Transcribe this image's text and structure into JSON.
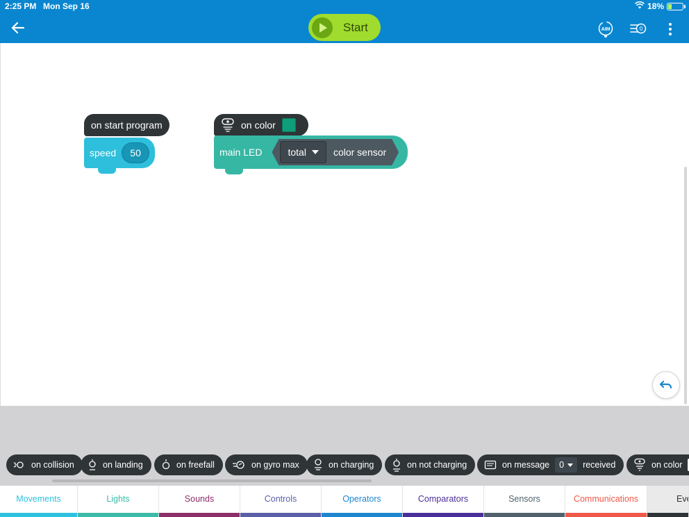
{
  "status": {
    "time": "2:25 PM",
    "date": "Mon Sep 16",
    "battery": "18%"
  },
  "toolbar": {
    "start_label": "Start"
  },
  "canvas": {
    "start_block": {
      "label": "on start program"
    },
    "speed_block": {
      "label": "speed",
      "value": "50"
    },
    "color_event": {
      "label": "on color",
      "swatch_color": "#0f9e7a"
    },
    "led_block": {
      "label": "main LED",
      "dropdown": "total",
      "sensor_label": "color sensor"
    }
  },
  "palette": {
    "blocks": [
      {
        "label": "on collision"
      },
      {
        "label": "on landing"
      },
      {
        "label": "on freefall"
      },
      {
        "label": "on gyro max"
      },
      {
        "label": "on charging"
      },
      {
        "label": "on not charging"
      },
      {
        "label": "on message",
        "dropdown": "0",
        "suffix": "received"
      },
      {
        "label": "on color"
      }
    ]
  },
  "tabs": [
    {
      "label": "Movements",
      "color": "#2fc2e0"
    },
    {
      "label": "Lights",
      "color": "#3dbba8"
    },
    {
      "label": "Sounds",
      "color": "#8f2f6a"
    },
    {
      "label": "Controls",
      "color": "#5a5fa8"
    },
    {
      "label": "Operators",
      "color": "#1f86cf"
    },
    {
      "label": "Comparators",
      "color": "#4b2f9a"
    },
    {
      "label": "Sensors",
      "color": "#50616b"
    },
    {
      "label": "Communications",
      "color": "#f0584a"
    },
    {
      "label": "Eve",
      "color": "#2f3437"
    }
  ]
}
